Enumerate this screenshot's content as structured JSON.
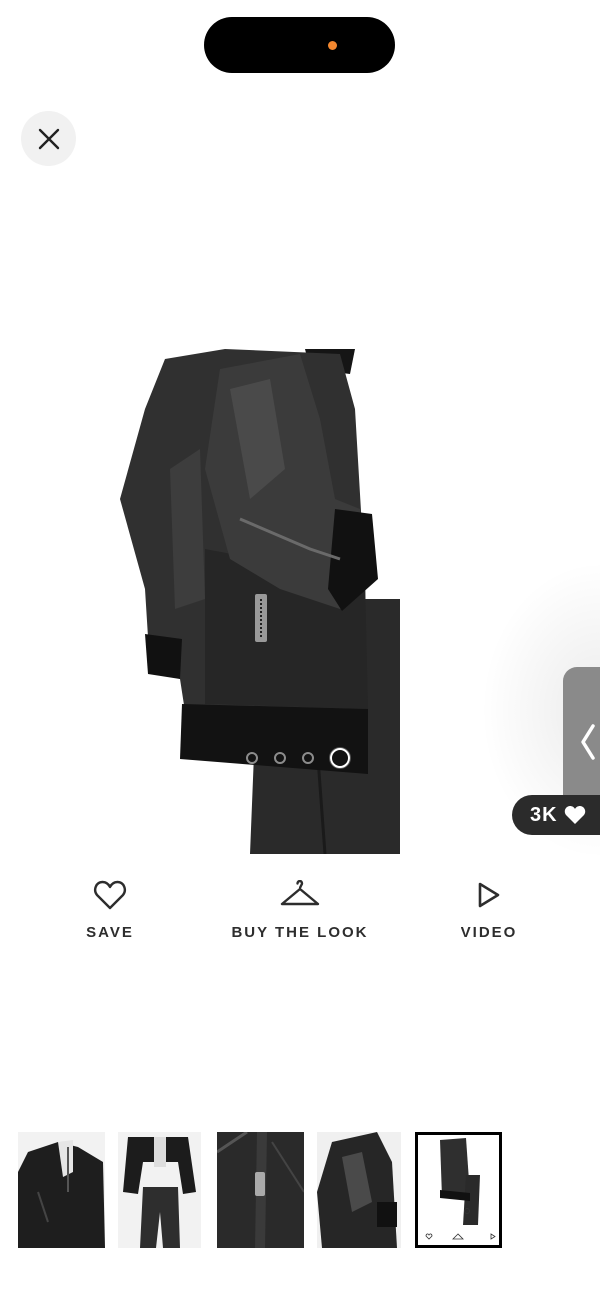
{
  "gallery": {
    "image_alt": "Black faux leather aviator jacket with borg trim",
    "image_count": 4,
    "active_index": 4
  },
  "likes": {
    "count": "3K"
  },
  "actions": [
    {
      "label": "SAVE",
      "icon": "heart-icon"
    },
    {
      "label": "BUY THE LOOK",
      "icon": "hanger-icon"
    },
    {
      "label": "VIDEO",
      "icon": "play-icon"
    }
  ],
  "thumbnails": [
    {
      "name": "thumb-1"
    },
    {
      "name": "thumb-2"
    },
    {
      "name": "thumb-3"
    },
    {
      "name": "thumb-4"
    },
    {
      "name": "thumb-5",
      "active": true
    }
  ],
  "colors": {
    "accent_dot": "#f2872f",
    "text": "#2d2d2d",
    "badge_bg": "#2b2b2b"
  }
}
